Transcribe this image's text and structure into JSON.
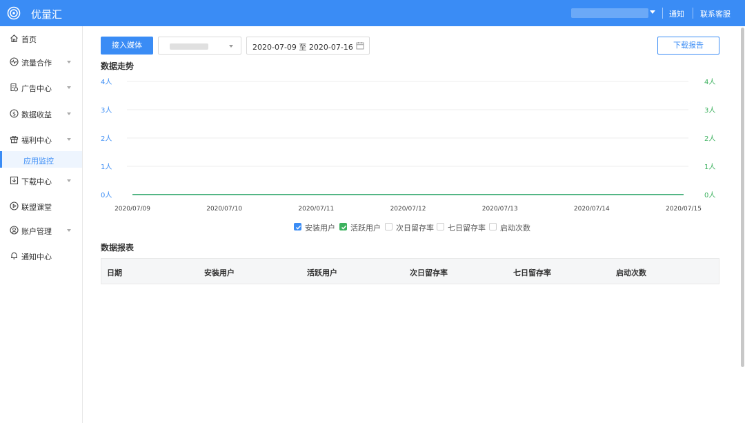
{
  "topbar": {
    "brand": "优量汇",
    "links": [
      "通知",
      "联系客服"
    ]
  },
  "sidebar": {
    "items": [
      {
        "label": "首页",
        "icon": "home-icon",
        "expandable": false
      },
      {
        "label": "流量合作",
        "icon": "pulse-icon",
        "expandable": true
      },
      {
        "label": "广告中心",
        "icon": "ad-icon",
        "expandable": true
      },
      {
        "label": "数据收益",
        "icon": "dollar-icon",
        "expandable": true
      },
      {
        "label": "福利中心",
        "icon": "gift-icon",
        "expandable": true
      },
      {
        "label": "下载中心",
        "icon": "download-icon",
        "expandable": true
      },
      {
        "label": "联盟课堂",
        "icon": "play-icon",
        "expandable": false
      },
      {
        "label": "账户管理",
        "icon": "user-icon",
        "expandable": true
      },
      {
        "label": "通知中心",
        "icon": "bell-icon",
        "expandable": false
      }
    ],
    "active_sub": "应用监控"
  },
  "toolbar": {
    "connect_label": "接入媒体",
    "date_range": "2020-07-09 至 2020-07-16",
    "download_label": "下载报告"
  },
  "trend": {
    "title": "数据走势"
  },
  "chart_data": {
    "type": "line",
    "x": [
      "2020/07/09",
      "2020/07/10",
      "2020/07/11",
      "2020/07/12",
      "2020/07/13",
      "2020/07/14",
      "2020/07/15"
    ],
    "y_ticks_left": [
      "0人",
      "1人",
      "2人",
      "3人",
      "4人"
    ],
    "y_ticks_right": [
      "0人",
      "1人",
      "2人",
      "3人",
      "4人"
    ],
    "ylim": [
      0,
      4
    ],
    "grid": true,
    "series": [
      {
        "name": "安装用户",
        "values": [
          0,
          0,
          0,
          0,
          0,
          0,
          0
        ],
        "color": "#3a8cf5",
        "checked": true
      },
      {
        "name": "活跃用户",
        "values": [
          0,
          0,
          0,
          0,
          0,
          0,
          0
        ],
        "color": "#3cb15e",
        "checked": true
      }
    ],
    "legend": [
      "安装用户",
      "活跃用户",
      "次日留存率",
      "七日留存率",
      "启动次数"
    ],
    "legend_checked": [
      true,
      true,
      false,
      false,
      false
    ],
    "legend_placement": "bottom"
  },
  "report": {
    "title": "数据报表",
    "columns": [
      "日期",
      "安装用户",
      "活跃用户",
      "次日留存率",
      "七日留存率",
      "启动次数"
    ]
  },
  "colors": {
    "accent": "#3a8cf5",
    "green": "#3cb15e"
  }
}
